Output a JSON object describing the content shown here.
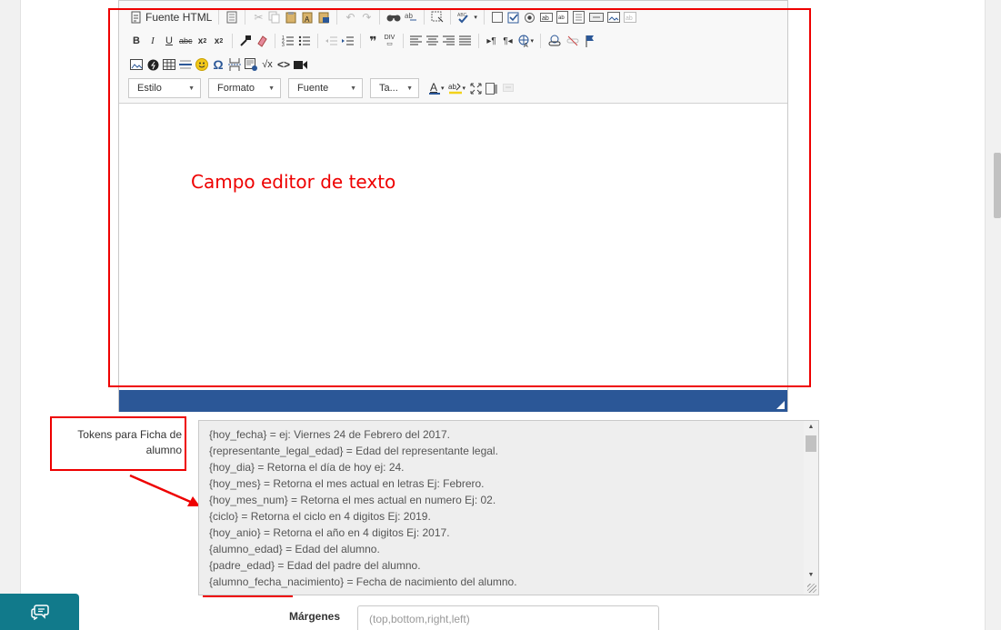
{
  "editor": {
    "source_label": "Fuente HTML",
    "combos": [
      {
        "label": "Estilo"
      },
      {
        "label": "Formato"
      },
      {
        "label": "Fuente"
      },
      {
        "label": "Ta..."
      }
    ],
    "statusbar_color": "#2b5797"
  },
  "annotation": {
    "editor_text": "Campo editor de texto",
    "color": "#e00000"
  },
  "tokens": {
    "label": "Tokens para Ficha de alumno",
    "lines": [
      "{hoy_fecha} = ej: Viernes 24 de Febrero del 2017.",
      "{representante_legal_edad} = Edad del representante legal.",
      "{hoy_dia} = Retorna el día de hoy ej: 24.",
      "{hoy_mes} = Retorna el mes actual en letras Ej: Febrero.",
      "{hoy_mes_num} = Retorna el mes actual en numero Ej: 02.",
      "{ciclo} = Retorna el ciclo en 4 digitos Ej: 2019.",
      "{hoy_anio} = Retorna el año en 4 digitos Ej: 2017.",
      "{alumno_edad} = Edad del alumno.",
      "{padre_edad} = Edad del padre del alumno.",
      "{alumno_fecha_nacimiento} = Fecha de nacimiento del alumno."
    ]
  },
  "margins": {
    "label": "Márgenes",
    "placeholder": "(top,bottom,right,left)"
  },
  "chat": {
    "icon": "chat-icon",
    "color": "#117a8b"
  }
}
